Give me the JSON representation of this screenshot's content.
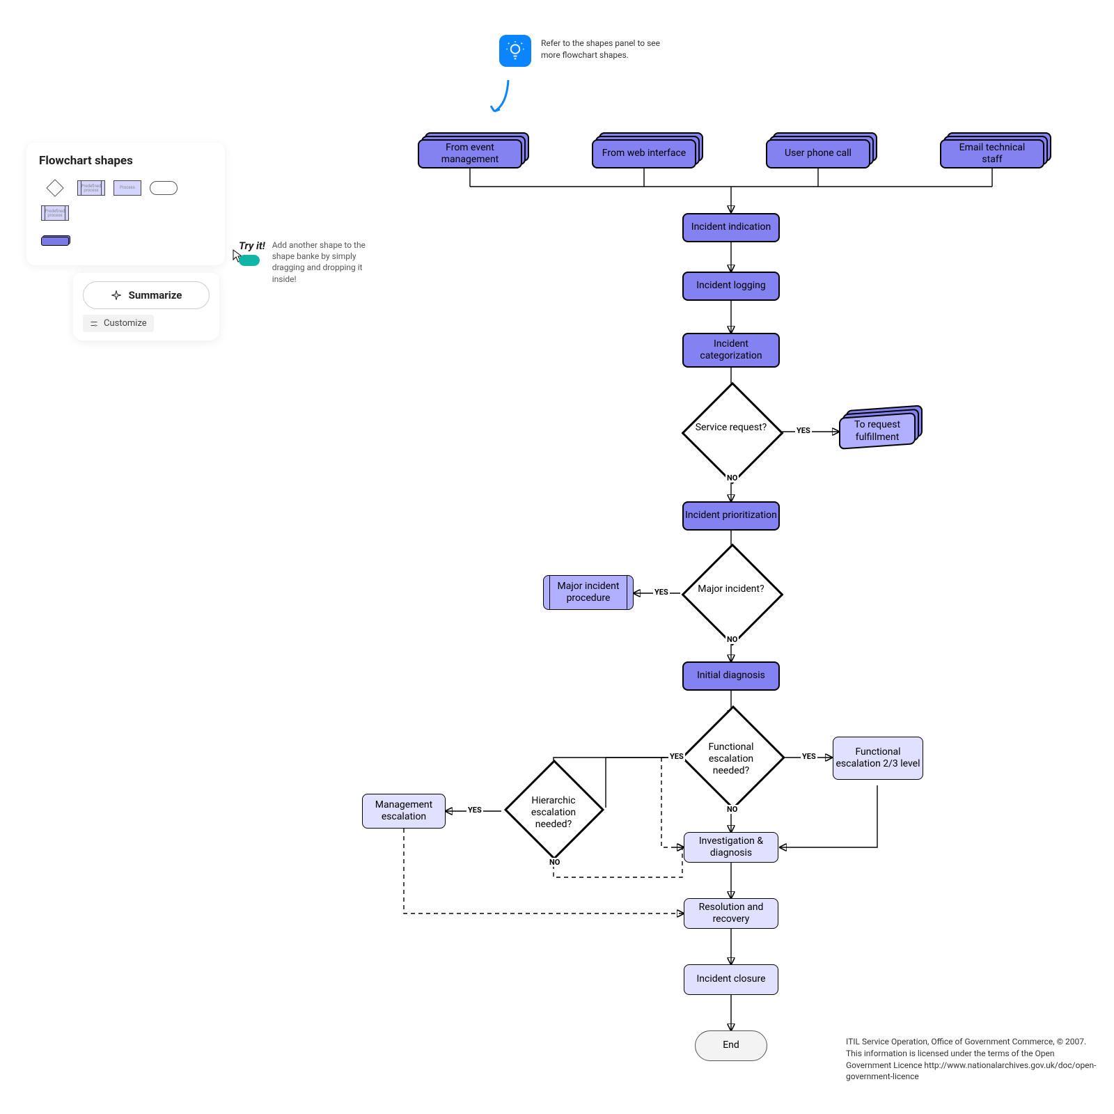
{
  "tip": {
    "text": "Refer to the shapes panel to see more flowchart shapes."
  },
  "shapes_panel": {
    "title": "Flowchart shapes",
    "items": [
      "Decision",
      "Predefined process",
      "Process",
      "Terminator",
      "Predefined process"
    ]
  },
  "tryit": {
    "title": "Try it!",
    "text": "Add another shape to the shape banke by simply dragging and dropping it inside!"
  },
  "summarize": {
    "button": "Summarize",
    "customize": "Customize"
  },
  "nodes": {
    "from_event": "From event management",
    "from_web": "From web interface",
    "user_phone": "User phone call",
    "email_tech": "Email technical staff",
    "incident_indication": "Incident indication",
    "incident_logging": "Incident logging",
    "incident_categorization": "Incident categorization",
    "service_request": "Service request?",
    "to_request": "To request fulfillment",
    "incident_prioritization": "Incident prioritization",
    "major_incident": "Major incident?",
    "major_incident_proc": "Major incident procedure",
    "initial_diagnosis": "Initial diagnosis",
    "functional_needed": "Functional escalation needed?",
    "functional_23": "Functional escalation 2/3 level",
    "hierarchic_needed": "Hierarchic escalation needed?",
    "management_esc": "Management escalation",
    "investigation": "Investigation & diagnosis",
    "resolution": "Resolution and recovery",
    "incident_closure": "Incident closure",
    "end": "End"
  },
  "labels": {
    "yes": "YES",
    "no": "NO"
  },
  "citation": "ITIL Service Operation, Office of Government Commerce, © 2007. This information is licensed under the terms of the Open Government Licence http://www.nationalarchives.gov.uk/doc/open-government-licence"
}
